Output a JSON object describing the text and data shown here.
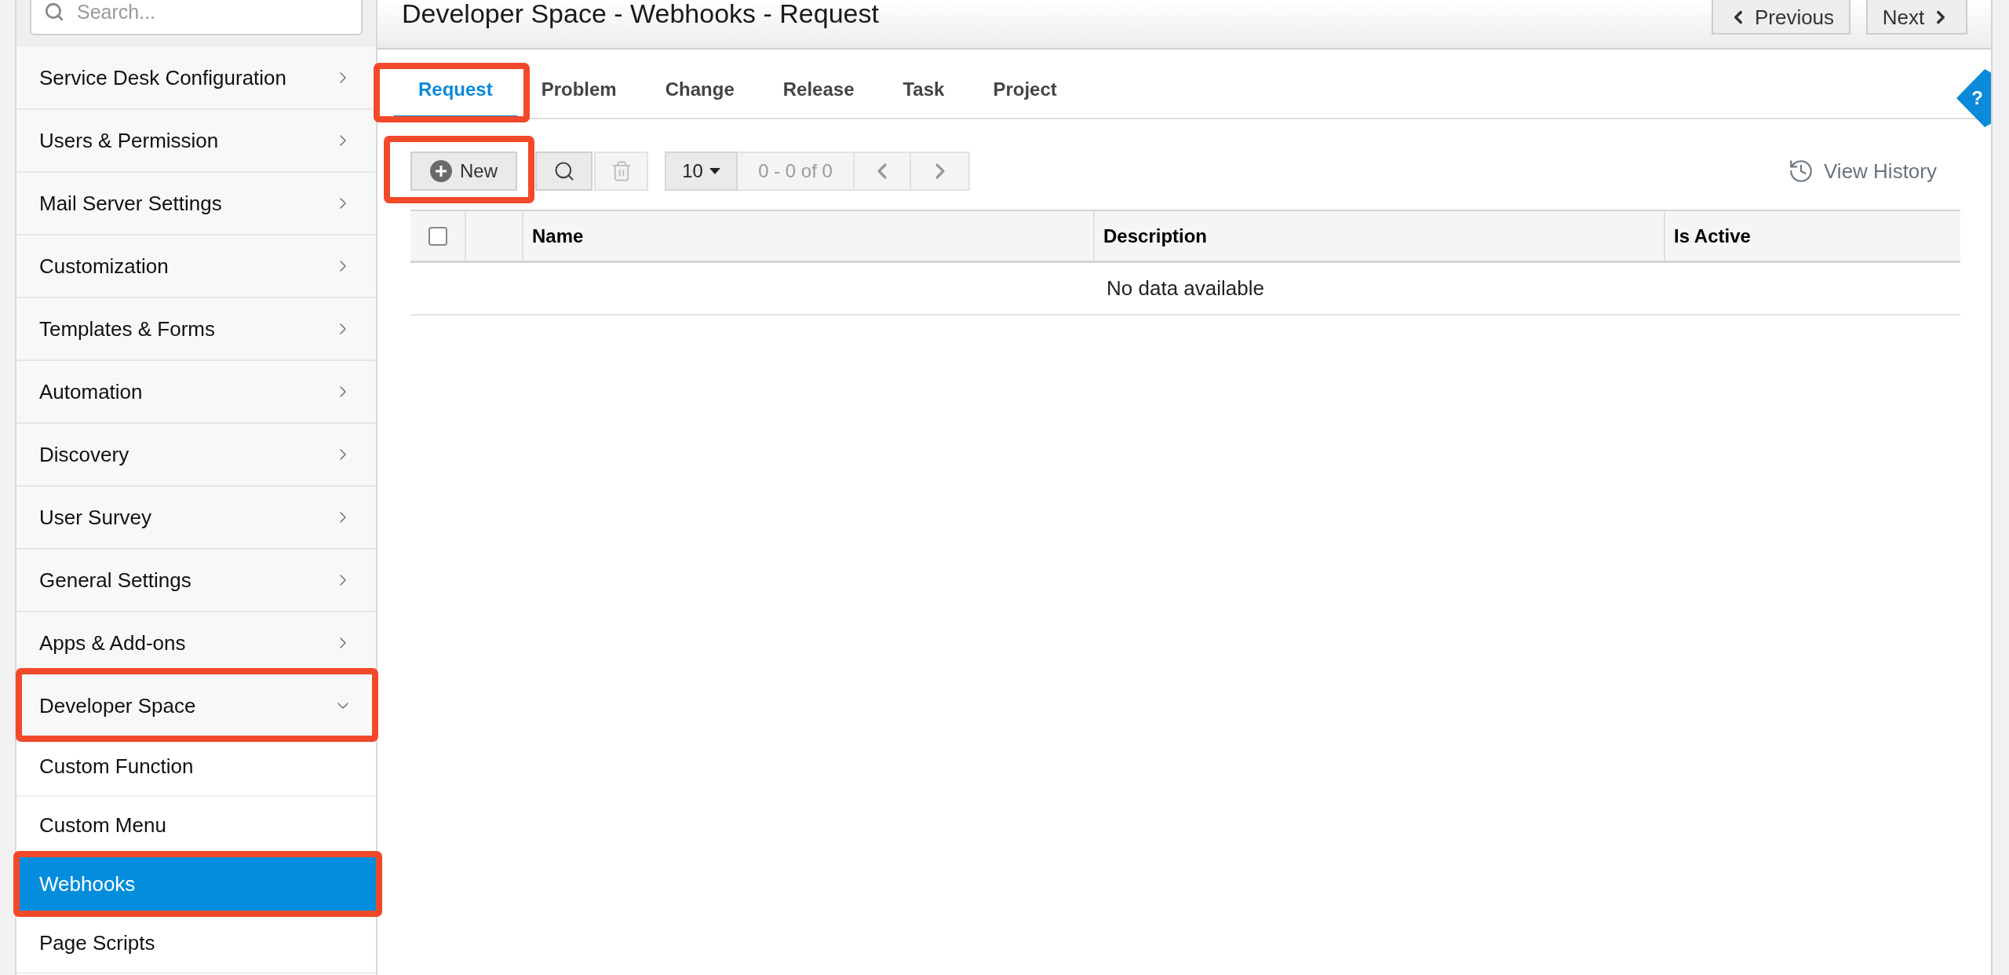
{
  "sidebar": {
    "search": {
      "placeholder": "Search..."
    },
    "items": [
      {
        "label": "Service Desk Configuration",
        "expanded": false,
        "highlighted": false
      },
      {
        "label": "Users & Permission",
        "expanded": false,
        "highlighted": false
      },
      {
        "label": "Mail Server Settings",
        "expanded": false,
        "highlighted": false
      },
      {
        "label": "Customization",
        "expanded": false,
        "highlighted": false
      },
      {
        "label": "Templates & Forms",
        "expanded": false,
        "highlighted": false
      },
      {
        "label": "Automation",
        "expanded": false,
        "highlighted": false
      },
      {
        "label": "Discovery",
        "expanded": false,
        "highlighted": false
      },
      {
        "label": "User Survey",
        "expanded": false,
        "highlighted": false
      },
      {
        "label": "General Settings",
        "expanded": false,
        "highlighted": false
      },
      {
        "label": "Apps & Add-ons",
        "expanded": false,
        "highlighted": false
      },
      {
        "label": "Developer Space",
        "expanded": true,
        "highlighted": true,
        "children": [
          {
            "label": "Custom Function",
            "selected": false,
            "highlighted": false
          },
          {
            "label": "Custom Menu",
            "selected": false,
            "highlighted": false
          },
          {
            "label": "Webhooks",
            "selected": true,
            "highlighted": true
          },
          {
            "label": "Page Scripts",
            "selected": false,
            "highlighted": false
          }
        ]
      }
    ]
  },
  "header": {
    "title": "Developer Space - Webhooks - Request",
    "buttons": [
      {
        "kind": "previous",
        "label": "Previous"
      },
      {
        "kind": "next",
        "label": "Next"
      }
    ]
  },
  "help_tab": {
    "label": "?"
  },
  "tabs": [
    {
      "label": "Request",
      "selected": true,
      "highlighted": true
    },
    {
      "label": "Problem",
      "selected": false,
      "highlighted": false
    },
    {
      "label": "Change",
      "selected": false,
      "highlighted": false
    },
    {
      "label": "Release",
      "selected": false,
      "highlighted": false
    },
    {
      "label": "Task",
      "selected": false,
      "highlighted": false
    },
    {
      "label": "Project",
      "selected": false,
      "highlighted": false
    }
  ],
  "toolbar": {
    "new_button": {
      "label": "New",
      "highlighted": true
    },
    "delete_button": {
      "disabled": true
    },
    "page_size": "10",
    "range": "0 - 0 of 0",
    "view_history": "View History"
  },
  "table": {
    "select_all": {
      "checked": false
    },
    "columns": [
      "Name",
      "Description",
      "Is Active"
    ],
    "empty_message": "No data available"
  }
}
